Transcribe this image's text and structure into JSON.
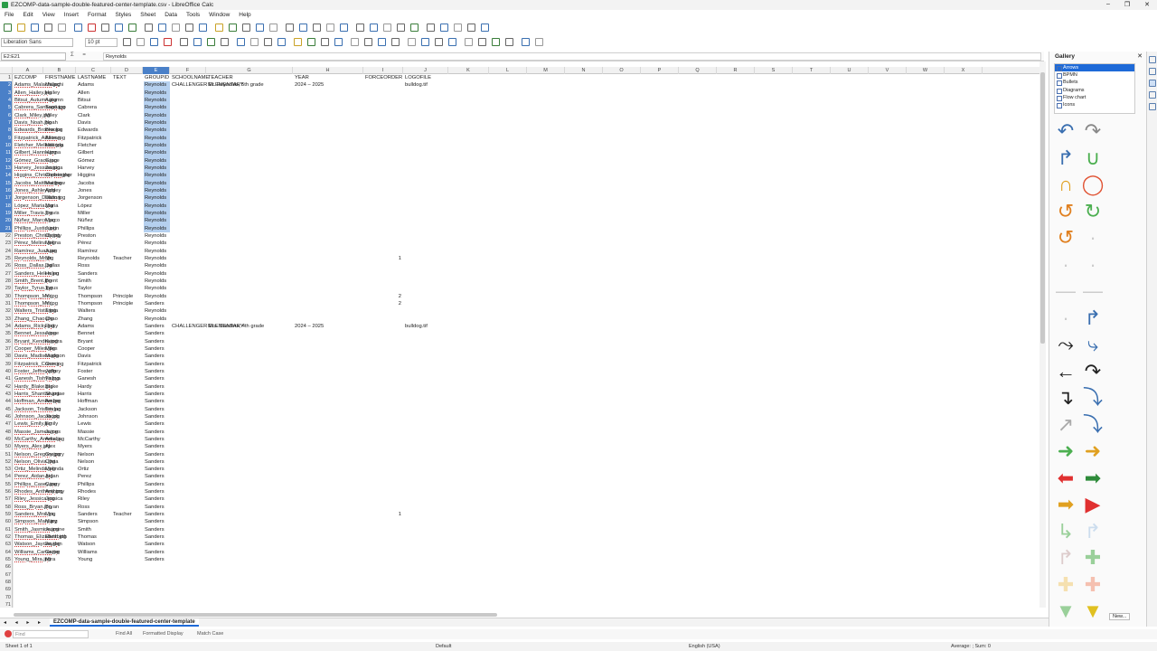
{
  "window": {
    "title": "EZCOMP-data-sample-double-featured-center-template.csv - LibreOffice Calc",
    "controls": [
      "–",
      "❐",
      "✕"
    ]
  },
  "menu": [
    "File",
    "Edit",
    "View",
    "Insert",
    "Format",
    "Styles",
    "Sheet",
    "Data",
    "Tools",
    "Window",
    "Help"
  ],
  "format": {
    "font_name": "Liberation Sans",
    "font_size": "10 pt"
  },
  "formula": {
    "cell_ref": "E2:E21",
    "fx_icons": "Σ =",
    "value": "Reynolds"
  },
  "columns": [
    "A",
    "B",
    "C",
    "D",
    "E",
    "F",
    "G",
    "H",
    "I",
    "J",
    "K",
    "L",
    "M",
    "N",
    "O",
    "P",
    "Q",
    "R",
    "S",
    "T",
    "U",
    "V",
    "W",
    "X"
  ],
  "headers": [
    "EZCOMP",
    "FIRSTNAME",
    "LASTNAME",
    "TEXT",
    "GROUPID",
    "SCHOOLNAME",
    "TEACHER",
    "YEAR",
    "FORCEORDER",
    "LOGOFILE"
  ],
  "rows": [
    [
      "Adams_Malachi.jpg",
      "Malachi",
      "Adams",
      "",
      "Reynolds",
      "CHALLENGER ELEMENTARY",
      "Mr. Reynolds, 5th grade",
      "2024 – 2025",
      "",
      "bulldog.tif"
    ],
    [
      "Allen_Hailey.jpg",
      "Hailey",
      "Allen",
      "",
      "Reynolds",
      "",
      "",
      "",
      "",
      ""
    ],
    [
      "Bitsui_Autumn.jpg",
      "Autumn",
      "Bitsui",
      "",
      "Reynolds",
      "",
      "",
      "",
      "",
      ""
    ],
    [
      "Cabrera_Santiago.jpg",
      "Santiago",
      "Cabrera",
      "",
      "Reynolds",
      "",
      "",
      "",
      "",
      ""
    ],
    [
      "Clark_Miley.jpg",
      "Miley",
      "Clark",
      "",
      "Reynolds",
      "",
      "",
      "",
      "",
      ""
    ],
    [
      "Davis_Noah.jpg",
      "Noah",
      "Davis",
      "",
      "Reynolds",
      "",
      "",
      "",
      "",
      ""
    ],
    [
      "Edwards_Brooke.jpg",
      "Brooke",
      "Edwards",
      "",
      "Reynolds",
      "",
      "",
      "",
      "",
      ""
    ],
    [
      "Fitzpatrick_Allison.jpg",
      "Allison",
      "Fitzpatrick",
      "",
      "Reynolds",
      "",
      "",
      "",
      "",
      ""
    ],
    [
      "Fletcher_Melinda.jpg",
      "Melinda",
      "Fletcher",
      "",
      "Reynolds",
      "",
      "",
      "",
      "",
      ""
    ],
    [
      "Gilbert_Hanna.jpg",
      "Hanna",
      "Gilbert",
      "",
      "Reynolds",
      "",
      "",
      "",
      "",
      ""
    ],
    [
      "Gómez_Grace.jpg",
      "Grace",
      "Gómez",
      "",
      "Reynolds",
      "",
      "",
      "",
      "",
      ""
    ],
    [
      "Harvey_Jessica.jpg",
      "Jessica",
      "Harvey",
      "",
      "Reynolds",
      "",
      "",
      "",
      "",
      ""
    ],
    [
      "Higgins_Christopher.jpg",
      "Christopher",
      "Higgins",
      "",
      "Reynolds",
      "",
      "",
      "",
      "",
      ""
    ],
    [
      "Jacobs_Matthew.jpg",
      "Matthew",
      "Jacobs",
      "",
      "Reynolds",
      "",
      "",
      "",
      "",
      ""
    ],
    [
      "Jones_Ashley.jpg",
      "Ashley",
      "Jones",
      "",
      "Reynolds",
      "",
      "",
      "",
      "",
      ""
    ],
    [
      "Jorgenson_Dalton.jpg",
      "Dalton",
      "Jorgenson",
      "",
      "Reynolds",
      "",
      "",
      "",
      "",
      ""
    ],
    [
      "López_Maria.jpg",
      "Maria",
      "López",
      "",
      "Reynolds",
      "",
      "",
      "",
      "",
      ""
    ],
    [
      "Miller_Travis.jpg",
      "Travis",
      "Miller",
      "",
      "Reynolds",
      "",
      "",
      "",
      "",
      ""
    ],
    [
      "Núñez_Marco.jpg",
      "Marco",
      "Núñez",
      "",
      "Reynolds",
      "",
      "",
      "",
      "",
      ""
    ],
    [
      "Phillips_Justin.jpg",
      "Justin",
      "Phillips",
      "",
      "Reynolds",
      "",
      "",
      "",
      "",
      ""
    ],
    [
      "Preston_Christy.jpg",
      "Christy",
      "Preston",
      "",
      "Reynolds",
      "",
      "",
      "",
      "",
      ""
    ],
    [
      "Pérez_Melina.jpg",
      "Melina",
      "Pérez",
      "",
      "Reynolds",
      "",
      "",
      "",
      "",
      ""
    ],
    [
      "Ramírez_Juan.jpg",
      "Juan",
      "Ramírez",
      "",
      "Reynolds",
      "",
      "",
      "",
      "",
      ""
    ],
    [
      "Reynolds_Mr.jpg",
      "Mr.",
      "Reynolds",
      "Teacher",
      "Reynolds",
      "",
      "",
      "",
      "1",
      ""
    ],
    [
      "Ross_Dallas.jpg",
      "Dallas",
      "Ross",
      "",
      "Reynolds",
      "",
      "",
      "",
      "",
      ""
    ],
    [
      "Sanders_Helen.jpg",
      "Helen",
      "Sanders",
      "",
      "Reynolds",
      "",
      "",
      "",
      "",
      ""
    ],
    [
      "Smith_Brent.jpg",
      "Brent",
      "Smith",
      "",
      "Reynolds",
      "",
      "",
      "",
      "",
      ""
    ],
    [
      "Taylor_Tyrus.jpg",
      "Tyrus",
      "Taylor",
      "",
      "Reynolds",
      "",
      "",
      "",
      "",
      ""
    ],
    [
      "Thompson_Mr..jpg",
      "Mr.",
      "Thompson",
      "Principle",
      "Reynolds",
      "",
      "",
      "",
      "2",
      ""
    ],
    [
      "Thompson_Mr..jpg",
      "Mr.",
      "Thompson",
      "Principle",
      "Sanders",
      "",
      "",
      "",
      "2",
      ""
    ],
    [
      "Walters_Trista.jpg",
      "Trista",
      "Walters",
      "",
      "Reynolds",
      "",
      "",
      "",
      "",
      ""
    ],
    [
      "Zhang_Chao.jpg",
      "Chao",
      "Zhang",
      "",
      "Reynolds",
      "",
      "",
      "",
      "",
      ""
    ],
    [
      "Adams_Ricky.jpg",
      "Ricky",
      "Adams",
      "",
      "Sanders",
      "CHALLENGER ELEMENTARY",
      "Mrs. Sanders, 4th grade",
      "2024 – 2025",
      "",
      "bulldog.tif"
    ],
    [
      "Bennet_Jesse.jpg",
      "Jesse",
      "Bennet",
      "",
      "Sanders",
      "",
      "",
      "",
      "",
      ""
    ],
    [
      "Bryant_Kendra.jpg",
      "Kendra",
      "Bryant",
      "",
      "Sanders",
      "",
      "",
      "",
      "",
      ""
    ],
    [
      "Cooper_Miles.jpg",
      "Miles",
      "Cooper",
      "",
      "Sanders",
      "",
      "",
      "",
      "",
      ""
    ],
    [
      "Davis_Madison.jpg",
      "Madison",
      "Davis",
      "",
      "Sanders",
      "",
      "",
      "",
      "",
      ""
    ],
    [
      "Fitzpatrick_Conor.jpg",
      "Conor",
      "Fitzpatrick",
      "",
      "Sanders",
      "",
      "",
      "",
      "",
      ""
    ],
    [
      "Foster_Jeffrey.jpg",
      "Jeffrey",
      "Foster",
      "",
      "Sanders",
      "",
      "",
      "",
      "",
      ""
    ],
    [
      "Ganesh_Tishya.jpg",
      "Tishya",
      "Ganesh",
      "",
      "Sanders",
      "",
      "",
      "",
      "",
      ""
    ],
    [
      "Hardy_Blake.jpg",
      "Blake",
      "Hardy",
      "",
      "Sanders",
      "",
      "",
      "",
      "",
      ""
    ],
    [
      "Harris_Shantae.jpg",
      "Shantae",
      "Harris",
      "",
      "Sanders",
      "",
      "",
      "",
      "",
      ""
    ],
    [
      "Hoffman_Amber.jpg",
      "Amber",
      "Hoffman",
      "",
      "Sanders",
      "",
      "",
      "",
      "",
      ""
    ],
    [
      "Jackson_Tristan.jpg",
      "Tristan",
      "Jackson",
      "",
      "Sanders",
      "",
      "",
      "",
      "",
      ""
    ],
    [
      "Johnson_Jacob.jpg",
      "Jacob",
      "Johnson",
      "",
      "Sanders",
      "",
      "",
      "",
      "",
      ""
    ],
    [
      "Lewis_Emily.jpg",
      "Emily",
      "Lewis",
      "",
      "Sanders",
      "",
      "",
      "",
      "",
      ""
    ],
    [
      "Massie_James.jpg",
      "James",
      "Massie",
      "",
      "Sanders",
      "",
      "",
      "",
      "",
      ""
    ],
    [
      "McCarthy_Amelia.jpg",
      "Amelia",
      "McCarthy",
      "",
      "Sanders",
      "",
      "",
      "",
      "",
      ""
    ],
    [
      "Myers_Alex.jpg",
      "Alex",
      "Myers",
      "",
      "Sanders",
      "",
      "",
      "",
      "",
      ""
    ],
    [
      "Nelson_Gregory.jpg",
      "Gregory",
      "Nelson",
      "",
      "Sanders",
      "",
      "",
      "",
      "",
      ""
    ],
    [
      "Nelson_Olivia.jpg",
      "Olivia",
      "Nelson",
      "",
      "Sanders",
      "",
      "",
      "",
      "",
      ""
    ],
    [
      "Ortiz_Melinda.jpg",
      "Melinda",
      "Ortiz",
      "",
      "Sanders",
      "",
      "",
      "",
      "",
      ""
    ],
    [
      "Perez_Aidan.jpg",
      "Aidan",
      "Perez",
      "",
      "Sanders",
      "",
      "",
      "",
      "",
      ""
    ],
    [
      "Phillips_Casey.jpg",
      "Casey",
      "Phillips",
      "",
      "Sanders",
      "",
      "",
      "",
      "",
      ""
    ],
    [
      "Rhodes_Anthony.jpg",
      "Anthony",
      "Rhodes",
      "",
      "Sanders",
      "",
      "",
      "",
      "",
      ""
    ],
    [
      "Riley_Jessica.jpg",
      "Jessica",
      "Riley",
      "",
      "Sanders",
      "",
      "",
      "",
      "",
      ""
    ],
    [
      "Ross_Bryan.jpg",
      "Bryan",
      "Ross",
      "",
      "Sanders",
      "",
      "",
      "",
      "",
      ""
    ],
    [
      "Sanders_Mrs..jpg",
      "Mrs.",
      "Sanders",
      "Teacher",
      "Sanders",
      "",
      "",
      "",
      "1",
      ""
    ],
    [
      "Simpson_Mary.jpg",
      "Mary",
      "Simpson",
      "",
      "Sanders",
      "",
      "",
      "",
      "",
      ""
    ],
    [
      "Smith_Jasmine.jpg",
      "Jasmine",
      "Smith",
      "",
      "Sanders",
      "",
      "",
      "",
      "",
      ""
    ],
    [
      "Thomas_Elizabeth.jpg",
      "Elizabeth",
      "Thomas",
      "",
      "Sanders",
      "",
      "",
      "",
      "",
      ""
    ],
    [
      "Watson_Jayden.jpg",
      "Jayden",
      "Watson",
      "",
      "Sanders",
      "",
      "",
      "",
      "",
      ""
    ],
    [
      "Williams_Carter.jpg",
      "Carter",
      "Williams",
      "",
      "Sanders",
      "",
      "",
      "",
      "",
      ""
    ],
    [
      "Young_Mira.jpg",
      "Mira",
      "Young",
      "",
      "Sanders",
      "",
      "",
      "",
      "",
      ""
    ]
  ],
  "empty_rows": 6,
  "gallery": {
    "title": "Gallery",
    "themes": [
      "Arrows",
      "BPMN",
      "Bullets",
      "Diagrams",
      "Flow chart",
      "Icons"
    ],
    "selected_theme": "Arrows",
    "new_button": "New..."
  },
  "sheet_tab": "EZCOMP-data-sample-double-featured-center-template",
  "findbar": {
    "placeholder": "Find",
    "find_all": "Find All",
    "formatted_display": "Formatted Display",
    "match_case": "Match Case"
  },
  "status": {
    "sheet": "Sheet 1 of 1",
    "page_style": "Default",
    "language": "English (USA)",
    "summary": "Average: ; Sum: 0"
  },
  "colors": {
    "selection_header": "#4a80c8",
    "selection_cell": "#b5d0ef",
    "accent": "#1e6ad8"
  }
}
